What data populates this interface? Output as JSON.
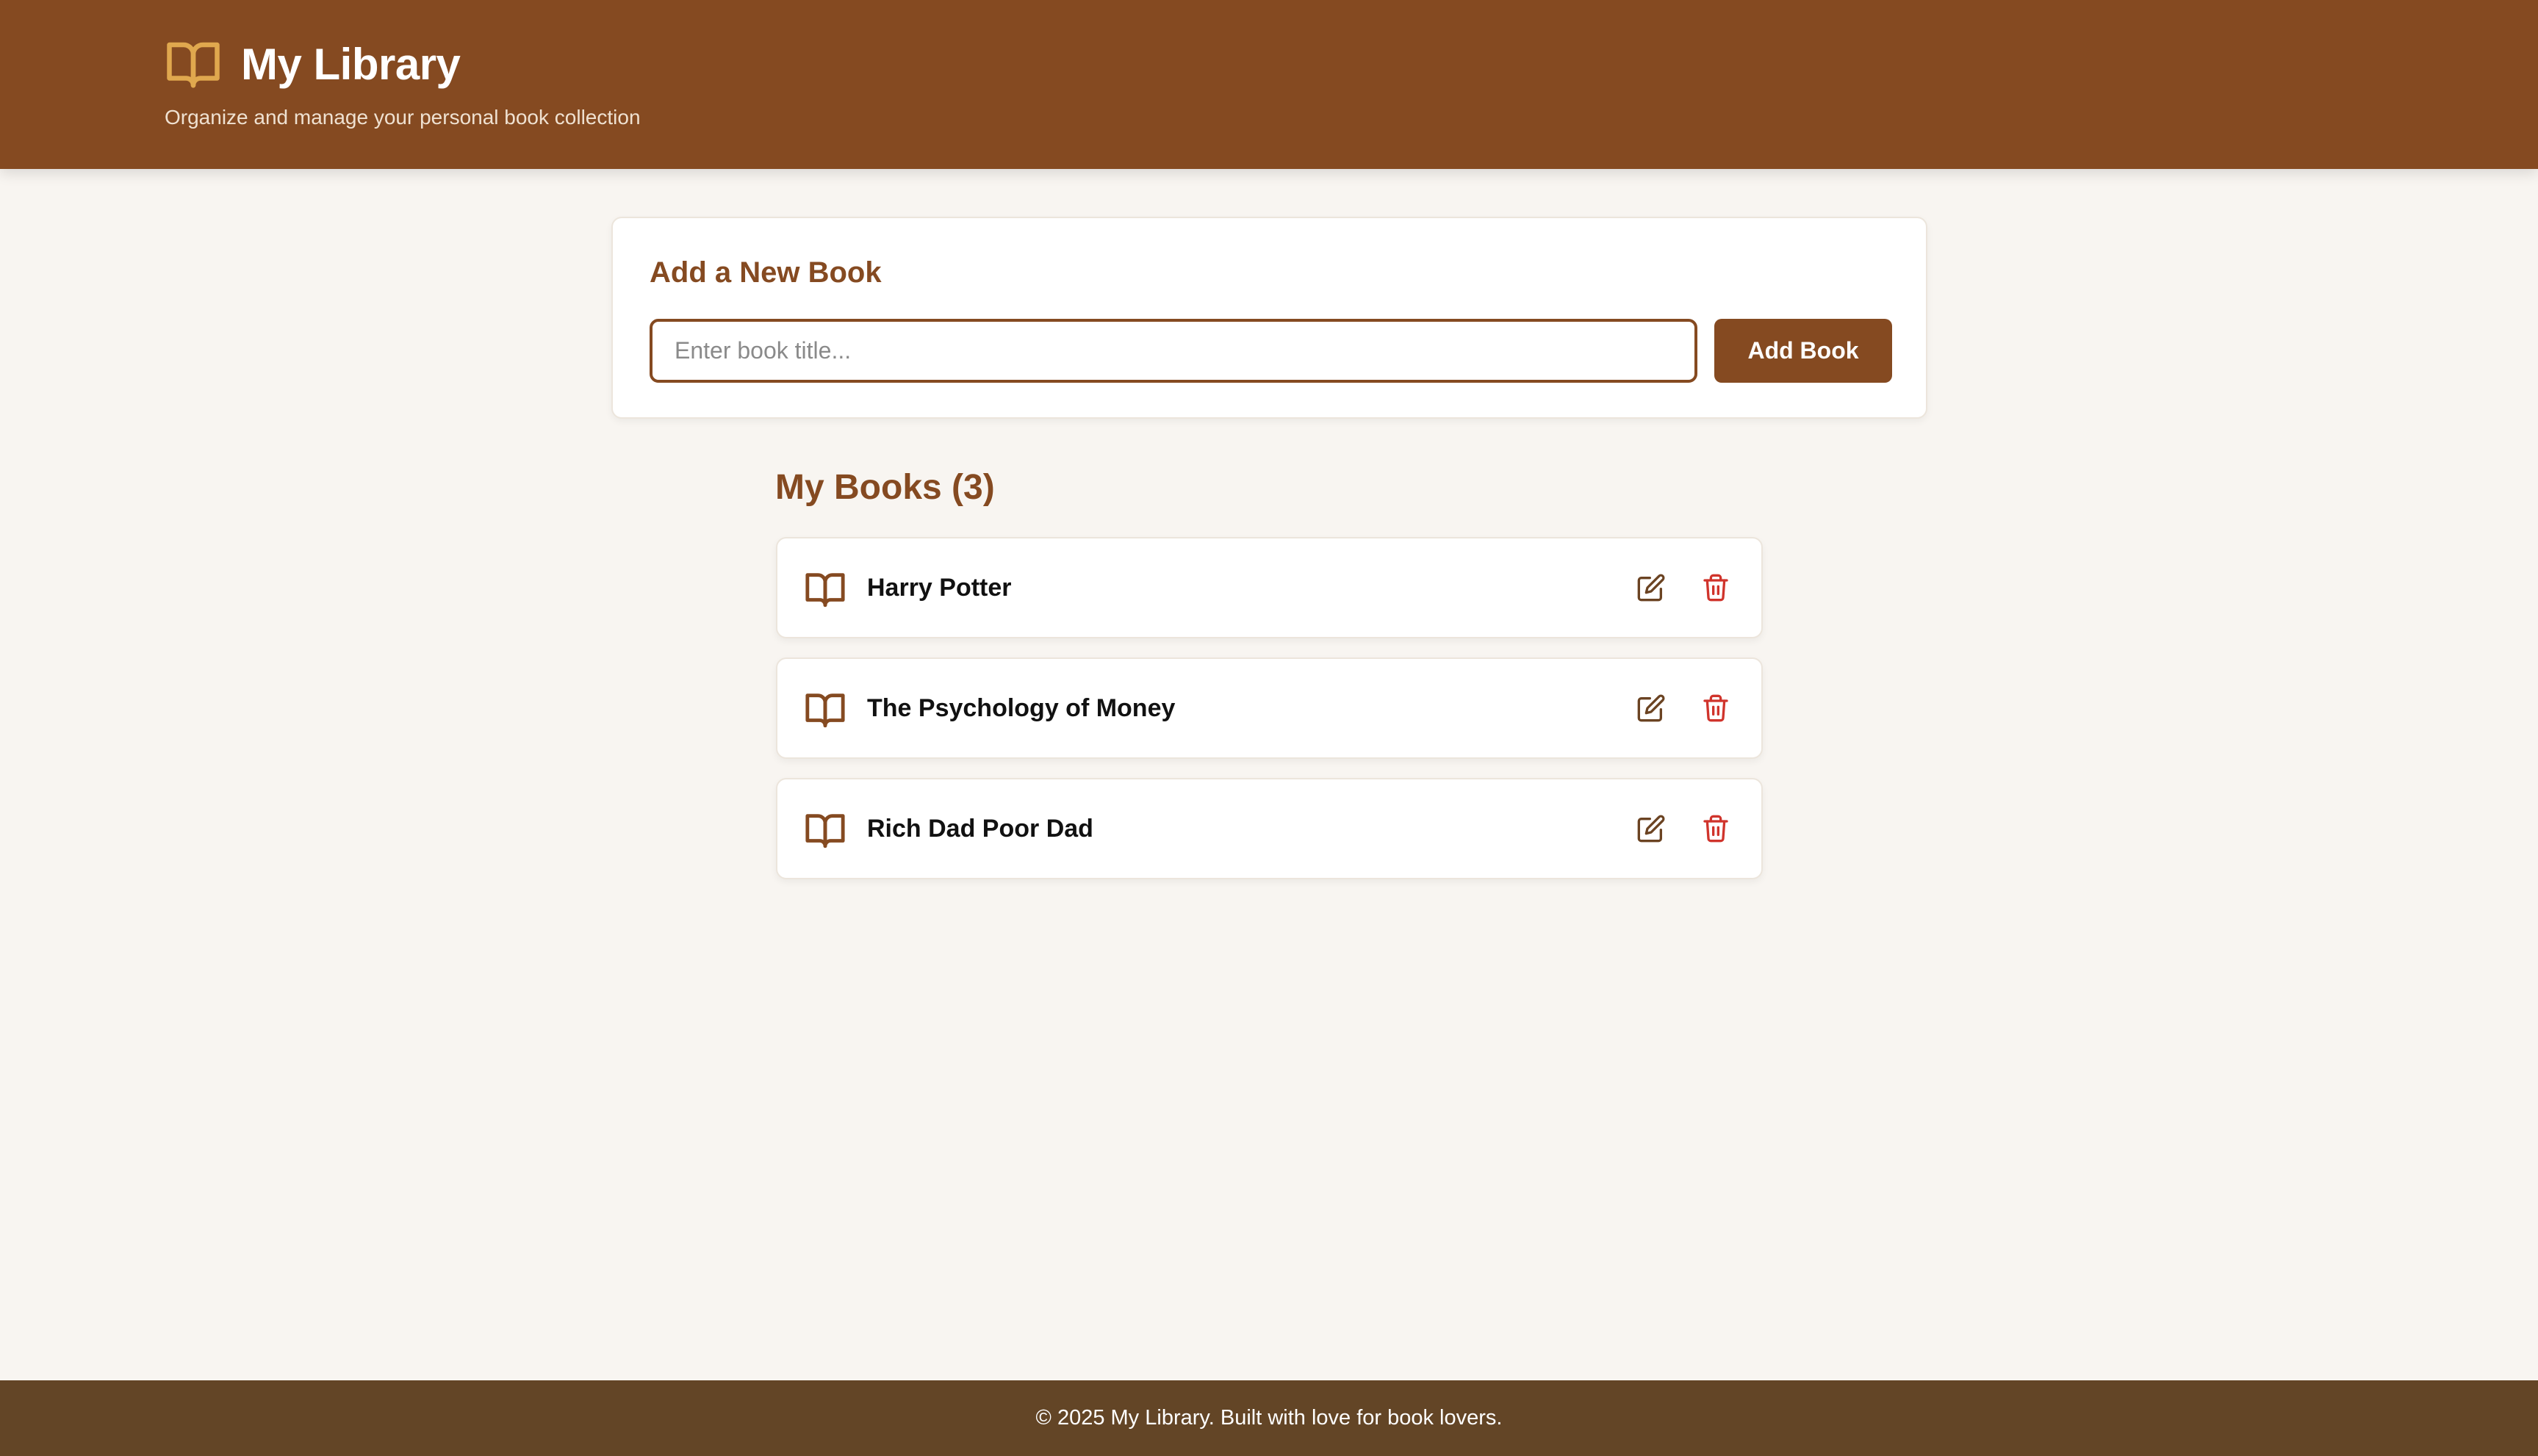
{
  "header": {
    "title": "My Library",
    "subtitle": "Organize and manage your personal book collection",
    "icon": "open-book-icon",
    "icon_color": "#e0a84e"
  },
  "add_book": {
    "heading": "Add a New Book",
    "input_value": "",
    "input_placeholder": "Enter book title...",
    "button_label": "Add Book"
  },
  "books": {
    "heading": "My Books (3)",
    "items": [
      {
        "title": "Harry Potter",
        "icon": "open-book-icon",
        "edit_icon": "edit-icon",
        "delete_icon": "trash-icon"
      },
      {
        "title": "The Psychology of Money",
        "icon": "open-book-icon",
        "edit_icon": "edit-icon",
        "delete_icon": "trash-icon"
      },
      {
        "title": "Rich Dad Poor Dad",
        "icon": "open-book-icon",
        "edit_icon": "edit-icon",
        "delete_icon": "trash-icon"
      }
    ]
  },
  "footer": {
    "text": "© 2025 My Library. Built with love for book lovers."
  },
  "colors": {
    "primary": "#854a21",
    "background": "#f8f5f1",
    "footer": "#634526",
    "danger": "#d0342c",
    "edit": "#6b4322"
  }
}
